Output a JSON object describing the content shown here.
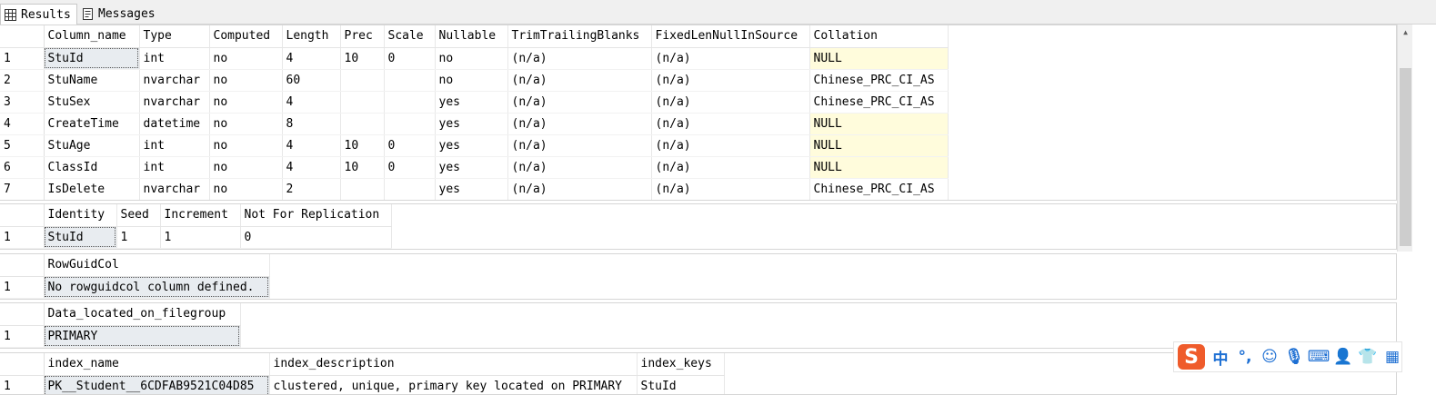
{
  "tabs": [
    {
      "label": "Results",
      "icon": "grid-icon",
      "active": true
    },
    {
      "label": "Messages",
      "icon": "messages-icon",
      "active": false
    }
  ],
  "columns_grid": {
    "headers": [
      "Column_name",
      "Type",
      "Computed",
      "Length",
      "Prec",
      "Scale",
      "Nullable",
      "TrimTrailingBlanks",
      "FixedLenNullInSource",
      "Collation"
    ],
    "rows": [
      [
        "1",
        "StuId",
        "int",
        "no",
        "4",
        "10",
        "0",
        "no",
        "(n/a)",
        "(n/a)",
        "NULL"
      ],
      [
        "2",
        "StuName",
        "nvarchar",
        "no",
        "60",
        "",
        "",
        "no",
        "(n/a)",
        "(n/a)",
        "Chinese_PRC_CI_AS"
      ],
      [
        "3",
        "StuSex",
        "nvarchar",
        "no",
        "4",
        "",
        "",
        "yes",
        "(n/a)",
        "(n/a)",
        "Chinese_PRC_CI_AS"
      ],
      [
        "4",
        "CreateTime",
        "datetime",
        "no",
        "8",
        "",
        "",
        "yes",
        "(n/a)",
        "(n/a)",
        "NULL"
      ],
      [
        "5",
        "StuAge",
        "int",
        "no",
        "4",
        "10",
        "0",
        "yes",
        "(n/a)",
        "(n/a)",
        "NULL"
      ],
      [
        "6",
        "ClassId",
        "int",
        "no",
        "4",
        "10",
        "0",
        "yes",
        "(n/a)",
        "(n/a)",
        "NULL"
      ],
      [
        "7",
        "IsDelete",
        "nvarchar",
        "no",
        "2",
        "",
        "",
        "yes",
        "(n/a)",
        "(n/a)",
        "Chinese_PRC_CI_AS"
      ]
    ]
  },
  "identity_grid": {
    "headers": [
      "Identity",
      "Seed",
      "Increment",
      "Not For Replication"
    ],
    "rows": [
      [
        "1",
        "StuId",
        "1",
        "1",
        "0"
      ]
    ]
  },
  "rowguid_grid": {
    "headers": [
      "RowGuidCol"
    ],
    "rows": [
      [
        "1",
        "No rowguidcol column defined."
      ]
    ]
  },
  "filegroup_grid": {
    "headers": [
      "Data_located_on_filegroup"
    ],
    "rows": [
      [
        "1",
        "PRIMARY"
      ]
    ]
  },
  "index_grid": {
    "headers": [
      "index_name",
      "index_description",
      "index_keys"
    ],
    "rows": [
      [
        "1",
        "PK__Student__6CDFAB9521C04D85",
        "clustered, unique, primary key located on PRIMARY",
        "StuId"
      ]
    ]
  },
  "ime_toolbar": {
    "logo": "S",
    "items": [
      {
        "label": "中",
        "icon": "chinese-mode-icon"
      },
      {
        "label": "°,",
        "icon": "punctuation-icon"
      },
      {
        "label": "☺",
        "icon": "emoji-icon"
      },
      {
        "label": "🎙",
        "icon": "microphone-icon"
      },
      {
        "label": "⌨",
        "icon": "keyboard-icon"
      },
      {
        "label": "👤",
        "icon": "user-icon"
      },
      {
        "label": "👕",
        "icon": "skin-icon"
      },
      {
        "label": "▦",
        "icon": "toolbox-icon"
      }
    ]
  }
}
